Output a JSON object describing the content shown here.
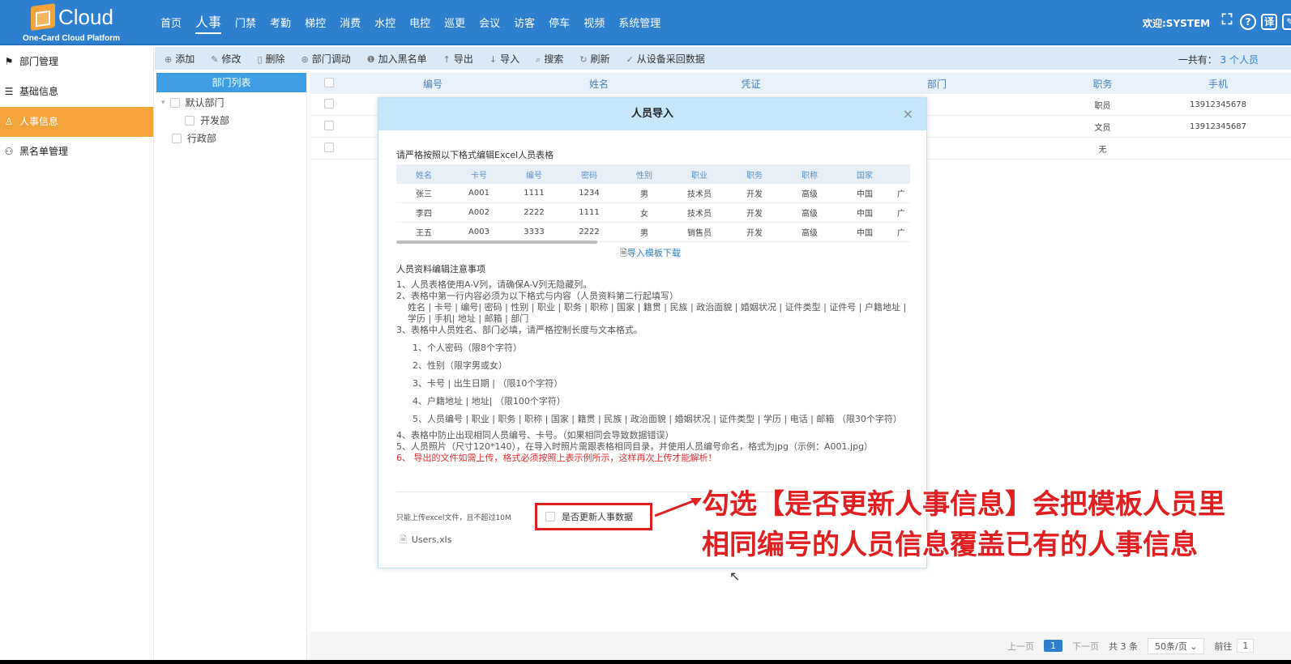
{
  "header": {
    "brand": "Cloud",
    "brand_sub": "One-Card Cloud Platform",
    "nav": [
      "首页",
      "人事",
      "门禁",
      "考勤",
      "梯控",
      "消费",
      "水控",
      "电控",
      "巡更",
      "会议",
      "访客",
      "停车",
      "视频",
      "系统管理"
    ],
    "active_nav": "人事",
    "welcome": "欢迎:SYSTEM",
    "icons": [
      "fullscreen-icon",
      "help-icon",
      "translate-icon",
      "edit-icon"
    ]
  },
  "sidebar": {
    "items": [
      {
        "label": "部门管理",
        "icon": "org-icon"
      },
      {
        "label": "基础信息",
        "icon": "list-icon"
      },
      {
        "label": "人事信息",
        "icon": "user-icon",
        "active": true
      },
      {
        "label": "黑名单管理",
        "icon": "blacklist-icon"
      }
    ]
  },
  "toolbar": {
    "buttons": [
      {
        "label": "添加",
        "icon": "⊕"
      },
      {
        "label": "修改",
        "icon": "✎"
      },
      {
        "label": "删除",
        "icon": "🗑"
      },
      {
        "label": "部门调动",
        "icon": "⊛"
      },
      {
        "label": "加入黑名单",
        "icon": "❶"
      },
      {
        "label": "导出",
        "icon": "↑"
      },
      {
        "label": "导入",
        "icon": "↓"
      },
      {
        "label": "搜索",
        "icon": "⌕"
      },
      {
        "label": "刷新",
        "icon": "↻"
      },
      {
        "label": "从设备采回数据",
        "icon": "✓"
      }
    ],
    "count_prefix": "一共有：",
    "count_value": "3 个人员"
  },
  "tree": {
    "title": "部门列表",
    "nodes": [
      {
        "label": "默认部门",
        "level": 0,
        "expander": "▾"
      },
      {
        "label": "开发部",
        "level": 1
      },
      {
        "label": "行政部",
        "level": 0
      }
    ]
  },
  "grid": {
    "columns": [
      "编号",
      "姓名",
      "凭证",
      "部门",
      "职务",
      "手机"
    ],
    "rows": [
      {
        "duty": "职员",
        "phone": "13912345678"
      },
      {
        "duty": "文员",
        "phone": "13912345687"
      },
      {
        "duty": "无",
        "phone": ""
      }
    ]
  },
  "pager": {
    "prev": "上一页",
    "current": "1",
    "next": "下一页",
    "total": "共 3 条",
    "per_page": "50条/页",
    "goto": "前往",
    "goto_value": "1"
  },
  "modal": {
    "title": "人员导入",
    "close": "×",
    "intro": "请严格按照以下格式编辑Excel人员表格",
    "sample_headers": [
      "姓名",
      "卡号",
      "编号",
      "密码",
      "性别",
      "职业",
      "职务",
      "职称",
      "国家",
      ""
    ],
    "sample_rows": [
      [
        "张三",
        "A001",
        "1111",
        "1234",
        "男",
        "技术员",
        "开发",
        "高级",
        "中国",
        "广"
      ],
      [
        "李四",
        "A002",
        "2222",
        "1111",
        "女",
        "技术员",
        "开发",
        "高级",
        "中国",
        "广"
      ],
      [
        "王五",
        "A003",
        "3333",
        "2222",
        "男",
        "销售员",
        "开发",
        "高级",
        "中国",
        "广"
      ]
    ],
    "template_link": "导入模板下载",
    "notes_title": "人员资料编辑注意事项",
    "notes": [
      "1、人员表格使用A-V列，请确保A-V列无隐藏列。",
      "2、表格中第一行内容必须为以下格式与内容（人员资料第二行起填写）",
      "姓名 | 卡号 | 编号| 密码 | 性别 | 职业 | 职务 | 职称 | 国家 | 籍贯 | 民族 | 政治面貌 | 婚姻状况 | 证件类型 | 证件号 | 户籍地址 | 学历 | 手机| 地址 | 邮箱 | 部门",
      "3、表格中人员姓名、部门必填，请严格控制长度与文本格式。",
      "1、个人密码（限8个字符）",
      "2、性别（限字男或女）",
      "3、卡号 | 出生日期 | （限10个字符）",
      "4、户籍地址 | 地址| （限100个字符）",
      "5、人员编号 | 职业 | 职务 | 职称 | 国家 | 籍贯 | 民族 | 政治面貌 | 婚姻状况 | 证件类型 | 学历 | 电话 | 邮箱 （限30个字符）",
      "4、表格中防止出现相同人员编号、卡号。（如果相同会导致数据错误）",
      "5、人员照片（尺寸120*140），在导入时照片需跟表格相同目录，并使用人员编号命名，格式为jpg（示例：A001.jpg）",
      "6、 导出的文件如需上传，格式必须按照上表示例所示，这样再次上传才能解析！"
    ],
    "upload_hint": "只能上传excel文件，且不超过10M",
    "update_checkbox_label": "是否更新人事数据",
    "file_name": "Users.xls"
  },
  "annotation": {
    "line1": "勾选【是否更新人事信息】会把模板人员里",
    "line2": "相同编号的人员信息覆盖已有的人事信息"
  },
  "colors": {
    "header": "#2f7fd1",
    "accent": "#f2a33a",
    "annotation": "#e02020"
  }
}
